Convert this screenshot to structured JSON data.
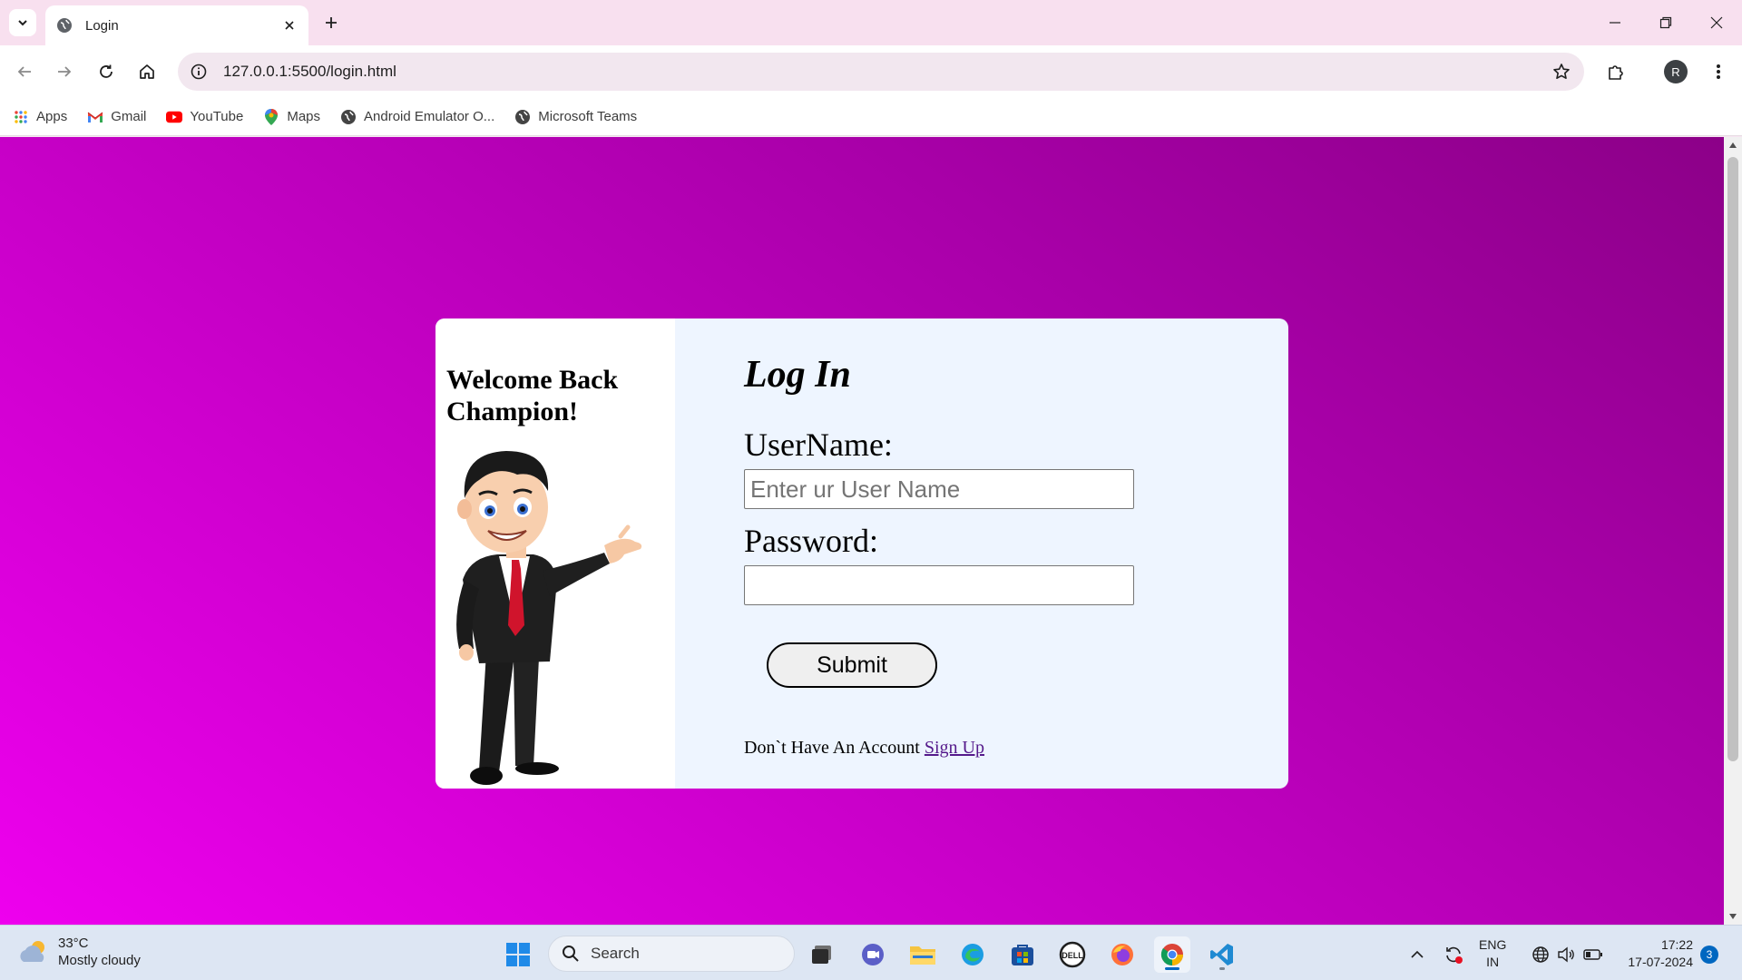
{
  "browser": {
    "tab_title": "Login",
    "url": "127.0.0.1:5500/login.html",
    "profile_initial": "R"
  },
  "bookmarks": [
    {
      "label": "Apps",
      "icon": "apps-grid-icon"
    },
    {
      "label": "Gmail",
      "icon": "gmail-icon"
    },
    {
      "label": "YouTube",
      "icon": "youtube-icon"
    },
    {
      "label": "Maps",
      "icon": "maps-icon"
    },
    {
      "label": "Android Emulator O...",
      "icon": "globe-icon"
    },
    {
      "label": "Microsoft Teams",
      "icon": "globe-icon"
    }
  ],
  "page": {
    "welcome": "Welcome Back Champion!",
    "title": "Log In",
    "username_label": "UserName:",
    "username_placeholder": "Enter ur User Name",
    "username_value": "",
    "password_label": "Password:",
    "password_value": "",
    "submit_label": "Submit",
    "signup_prompt": "Don`t Have An Account",
    "signup_link": "Sign Up",
    "background_colors": [
      "#ee00ee",
      "#8c0088"
    ],
    "card_color": "#eef5ff"
  },
  "taskbar": {
    "weather_temp": "33°C",
    "weather_desc": "Mostly cloudy",
    "search_label": "Search",
    "lang_line1": "ENG",
    "lang_line2": "IN",
    "time": "17:22",
    "date": "17-07-2024",
    "notification_count": "3",
    "apps": [
      "windows-start-icon",
      "task-view-icon",
      "teams-meet-icon",
      "file-explorer-icon",
      "edge-icon",
      "microsoft-store-icon",
      "dell-icon",
      "firefox-icon",
      "chrome-icon",
      "vscode-icon"
    ]
  }
}
